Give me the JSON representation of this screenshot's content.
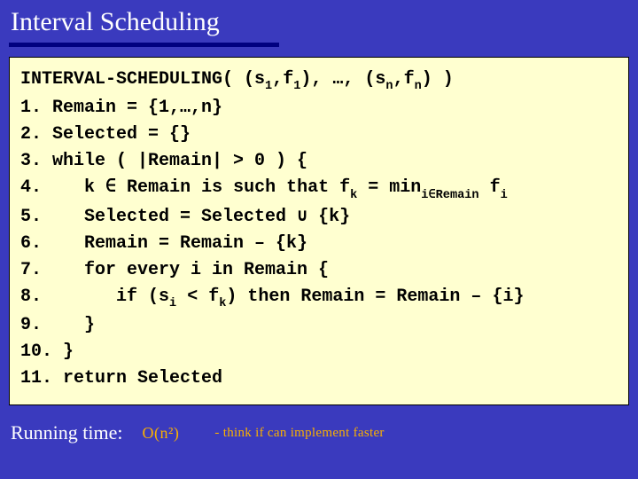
{
  "title": "Interval Scheduling",
  "code": {
    "header_a": "INTERVAL-SCHEDULING( (s",
    "header_b": ",f",
    "header_c": "), …, (s",
    "header_d": ",f",
    "header_e": ") )",
    "sub1": "1",
    "subn": "n",
    "l1": "1. Remain = {1,…,n}",
    "l2": "2. Selected = {}",
    "l3": "3. while ( |Remain| > 0 ) {",
    "l4_a": "4.    k ∈ Remain is such that f",
    "l4_b": " = min",
    "l4_c": " f",
    "l4_subk": "k",
    "l4_submin": "i∈Remain",
    "l4_subi": "i",
    "l5": "5.    Selected = Selected ∪ {k}",
    "l6": "6.    Remain = Remain – {k}",
    "l7": "7.    for every i in Remain {",
    "l8_a": "8.       if (s",
    "l8_b": " < f",
    "l8_c": ") then Remain = Remain – {i}",
    "l8_subi": "i",
    "l8_subk": "k",
    "l9": "9.    }",
    "l10": "10. }",
    "l11": "11. return Selected"
  },
  "running": {
    "label": "Running time:",
    "complexity": "O(n²)",
    "note": "-  think if can implement faster"
  }
}
